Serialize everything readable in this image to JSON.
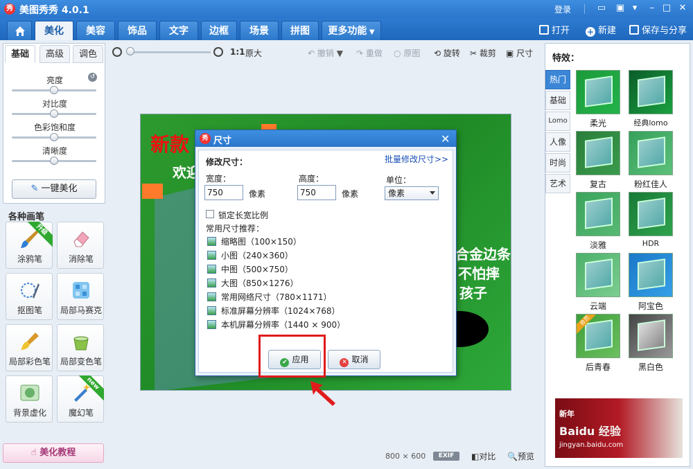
{
  "app": {
    "title": "美图秀秀 4.0.1",
    "logo_text": "秀",
    "login": "登录",
    "icons": [
      "message-icon",
      "skin-icon",
      "menu-icon",
      "minimize-icon",
      "maximize-icon",
      "close-icon"
    ]
  },
  "menu": {
    "tabs": [
      "美化",
      "美容",
      "饰品",
      "文字",
      "边框",
      "场景",
      "拼图",
      "更多功能"
    ],
    "active": "美化",
    "actions": {
      "open": "打开",
      "new": "新建",
      "save": "保存与分享"
    }
  },
  "left": {
    "subtabs": [
      "基础",
      "高级",
      "调色"
    ],
    "sliders": [
      {
        "label": "亮度",
        "value": 0.5
      },
      {
        "label": "对比度",
        "value": 0.5
      },
      {
        "label": "色彩饱和度",
        "value": 0.5
      },
      {
        "label": "清晰度",
        "value": 0.5
      }
    ],
    "one_key": "一键美化",
    "brushes_title": "各种画笔",
    "brushes": [
      {
        "label": "涂鸦笔",
        "badge": "升级"
      },
      {
        "label": "消除笔",
        "badge": ""
      },
      {
        "label": "抠图笔",
        "badge": ""
      },
      {
        "label": "局部马赛克",
        "badge": ""
      },
      {
        "label": "局部彩色笔",
        "badge": ""
      },
      {
        "label": "局部变色笔",
        "badge": ""
      },
      {
        "label": "背景虚化",
        "badge": ""
      },
      {
        "label": "魔幻笔",
        "badge": "new"
      }
    ],
    "tutorial": "美化教程"
  },
  "toolbar": {
    "ratio": "1:1",
    "original_size": "原大",
    "undo": "撤销",
    "redo": "重做",
    "original": "原图",
    "rotate": "旋转",
    "crop": "裁剪",
    "resize": "尺寸",
    "zoom_level": 0.0
  },
  "canvas": {
    "text_red": "新款",
    "text_white1": "欢迎",
    "text_white2": "合金边条",
    "text_white3": "不怕摔",
    "text_white4": "孩子"
  },
  "status": {
    "width": "800",
    "x": "×",
    "height": "600",
    "exif": "EXIF",
    "compare": "对比",
    "preview": "预览"
  },
  "right": {
    "title": "特效：",
    "tabs": [
      "热门",
      "基础",
      "Lomo",
      "人像",
      "时尚",
      "艺术"
    ],
    "active_tab": "热门",
    "effects": [
      "柔光",
      "经典lomo",
      "复古",
      "粉红佳人",
      "淡雅",
      "HDR",
      "云端",
      "阿宝色",
      "后青春",
      "黑白色"
    ],
    "badge_after_youth": "会员",
    "ad": {
      "line1": "新年",
      "line2": "Baidu 经验",
      "line3": "jingyan.baidu.com"
    }
  },
  "dialog": {
    "title": "尺寸",
    "logo": "秀",
    "section": "修改尺寸：",
    "batch_link": "批量修改尺寸>>",
    "width_label": "宽度：",
    "width_value": "750",
    "width_unit": "像素",
    "height_label": "高度：",
    "height_value": "750",
    "height_unit": "像素",
    "unit_label": "单位：",
    "unit_value": "像素",
    "lock_label": "锁定长宽比例",
    "lock_checked": false,
    "presets_title": "常用尺寸推荐：",
    "presets": [
      "缩略图（100×150）",
      "小图（240×360）",
      "中图（500×750）",
      "大图（850×1276）",
      "常用网络尺寸（780×1171）",
      "标准屏幕分辨率（1024×768）",
      "本机屏幕分辨率（1440 × 900）"
    ],
    "apply": "应用",
    "cancel": "取消"
  },
  "colors": {
    "titlebar": "#2a76cc",
    "highlight": "#e01b1b",
    "link": "#1a4fb5"
  }
}
